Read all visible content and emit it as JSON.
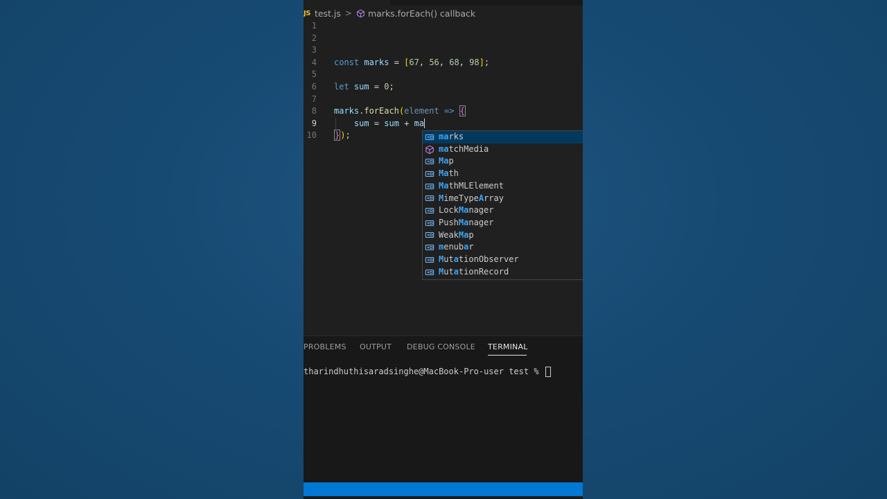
{
  "breadcrumb": {
    "file_badge": "JS",
    "file_name": "test.js",
    "separator": ">",
    "symbol": "marks.forEach() callback"
  },
  "code_lines": [
    {
      "number": "1"
    },
    {
      "number": "2"
    },
    {
      "number": "3"
    },
    {
      "number": "4",
      "tokens": [
        {
          "t": "const ",
          "c": "kw"
        },
        {
          "t": "marks",
          "c": "var"
        },
        {
          "t": " = ",
          "c": ""
        },
        {
          "t": "[",
          "c": "br2"
        },
        {
          "t": "67",
          "c": "num"
        },
        {
          "t": ", ",
          "c": ""
        },
        {
          "t": "56",
          "c": "num"
        },
        {
          "t": ", ",
          "c": ""
        },
        {
          "t": "68",
          "c": "num"
        },
        {
          "t": ", ",
          "c": ""
        },
        {
          "t": "98",
          "c": "num"
        },
        {
          "t": "]",
          "c": "br2"
        },
        {
          "t": ";",
          "c": ""
        }
      ]
    },
    {
      "number": "5"
    },
    {
      "number": "6",
      "tokens": [
        {
          "t": "let ",
          "c": "kw"
        },
        {
          "t": "sum",
          "c": "var"
        },
        {
          "t": " = ",
          "c": ""
        },
        {
          "t": "0",
          "c": "num"
        },
        {
          "t": ";",
          "c": ""
        }
      ]
    },
    {
      "number": "7"
    },
    {
      "number": "8",
      "tokens": [
        {
          "t": "marks",
          "c": "var"
        },
        {
          "t": ".",
          "c": ""
        },
        {
          "t": "forEach",
          "c": "fn"
        },
        {
          "t": "(",
          "c": "br2"
        },
        {
          "t": "element",
          "c": "param"
        },
        {
          "t": " ",
          "c": ""
        },
        {
          "t": "=>",
          "c": "kw"
        },
        {
          "t": " ",
          "c": ""
        },
        {
          "t": "{",
          "c": "br1 br-match"
        }
      ]
    },
    {
      "number": "9",
      "active": true,
      "tokens": [
        {
          "t": "    ",
          "c": ""
        },
        {
          "t": "sum",
          "c": "var"
        },
        {
          "t": " = ",
          "c": ""
        },
        {
          "t": "sum",
          "c": "var"
        },
        {
          "t": " + ",
          "c": ""
        },
        {
          "t": "ma",
          "c": "var"
        }
      ],
      "cursor": true
    },
    {
      "number": "10",
      "tokens": [
        {
          "t": "}",
          "c": "br1 br-match"
        },
        {
          "t": ")",
          "c": "br2"
        },
        {
          "t": ";",
          "c": ""
        }
      ]
    }
  ],
  "suggestions": [
    {
      "icon": "variable-icon",
      "parts": [
        {
          "t": "ma",
          "h": true
        },
        {
          "t": "rks",
          "h": false
        }
      ],
      "selected": true
    },
    {
      "icon": "method-icon",
      "parts": [
        {
          "t": "ma",
          "h": true
        },
        {
          "t": "tchMedia",
          "h": false
        }
      ]
    },
    {
      "icon": "variable-icon",
      "parts": [
        {
          "t": "Ma",
          "h": true
        },
        {
          "t": "p",
          "h": false
        }
      ]
    },
    {
      "icon": "variable-icon",
      "parts": [
        {
          "t": "Ma",
          "h": true
        },
        {
          "t": "th",
          "h": false
        }
      ]
    },
    {
      "icon": "variable-icon",
      "parts": [
        {
          "t": "Ma",
          "h": true
        },
        {
          "t": "thMLElement",
          "h": false
        }
      ]
    },
    {
      "icon": "variable-icon",
      "parts": [
        {
          "t": "M",
          "h": true
        },
        {
          "t": "imeType",
          "h": false
        },
        {
          "t": "A",
          "h": true
        },
        {
          "t": "rray",
          "h": false
        }
      ]
    },
    {
      "icon": "variable-icon",
      "parts": [
        {
          "t": "Lock",
          "h": false
        },
        {
          "t": "Ma",
          "h": true
        },
        {
          "t": "nager",
          "h": false
        }
      ]
    },
    {
      "icon": "variable-icon",
      "parts": [
        {
          "t": "Push",
          "h": false
        },
        {
          "t": "Ma",
          "h": true
        },
        {
          "t": "nager",
          "h": false
        }
      ]
    },
    {
      "icon": "variable-icon",
      "parts": [
        {
          "t": "Weak",
          "h": false
        },
        {
          "t": "Ma",
          "h": true
        },
        {
          "t": "p",
          "h": false
        }
      ]
    },
    {
      "icon": "variable-icon",
      "parts": [
        {
          "t": "m",
          "h": true
        },
        {
          "t": "enub",
          "h": false
        },
        {
          "t": "a",
          "h": true
        },
        {
          "t": "r",
          "h": false
        }
      ]
    },
    {
      "icon": "variable-icon",
      "parts": [
        {
          "t": "M",
          "h": true
        },
        {
          "t": "ut",
          "h": false
        },
        {
          "t": "a",
          "h": true
        },
        {
          "t": "tionObserver",
          "h": false
        }
      ]
    },
    {
      "icon": "variable-icon",
      "parts": [
        {
          "t": "M",
          "h": true
        },
        {
          "t": "ut",
          "h": false
        },
        {
          "t": "a",
          "h": true
        },
        {
          "t": "tionRecord",
          "h": false
        }
      ]
    }
  ],
  "panel": {
    "tabs": [
      "PROBLEMS",
      "OUTPUT",
      "DEBUG CONSOLE",
      "TERMINAL"
    ],
    "active_tab": "TERMINAL",
    "terminal_prompt": "tharindhuthisaradsinghe@MacBook-Pro-user test % "
  },
  "colors": {
    "status_bar": "#0078d4",
    "editor_bg": "#1f1f1f",
    "match_highlight": "#3ba4f5",
    "selected_row": "#04395e"
  }
}
